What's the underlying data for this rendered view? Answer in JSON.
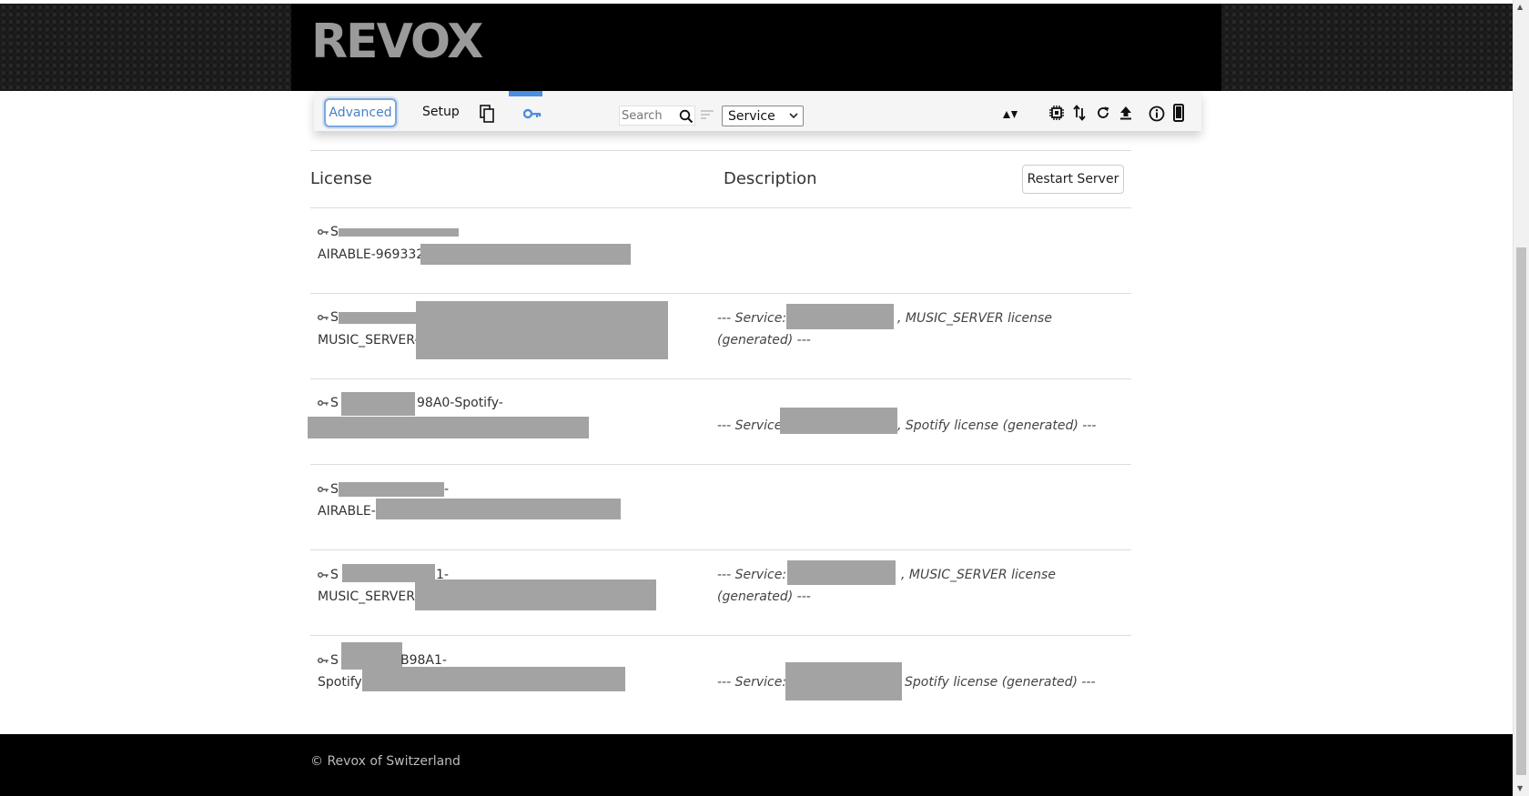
{
  "header": {
    "logo_text": "REVOX"
  },
  "toolbar": {
    "advanced_label": "Advanced",
    "setup_label": "Setup",
    "search_placeholder": "Search",
    "service_select_value": "Service",
    "icons": [
      "copy-icon",
      "key-icon",
      "search-icon",
      "sort-icon",
      "sort-updown-icon",
      "chip-icon",
      "transfer-icon",
      "refresh-icon",
      "upload-icon",
      "info-icon",
      "mobile-icon"
    ],
    "active_tab_color": "#4a8ee0"
  },
  "table": {
    "headers": {
      "license": "License",
      "description": "Description"
    },
    "restart_label": "Restart Server",
    "rows": [
      {
        "line1": "S",
        "line2": "AIRABLE-969332",
        "description": ""
      },
      {
        "line1": "S",
        "line2": "MUSIC_SERVER-",
        "description": "--- Service: , MUSIC_SERVER license (generated) ---",
        "description_line1": "--- Service:",
        "description_line1_suffix": ", MUSIC_SERVER license",
        "description_line2": "(generated) ---"
      },
      {
        "line1": "S",
        "line1_suffix": "98A0-Spotify-",
        "line2": "",
        "description_prefix": "--- Service:",
        "description_suffix": ", Spotify license (generated) ---"
      },
      {
        "line1": "S",
        "line1_suffix": "-",
        "line2": "AIRABLE-2",
        "description": ""
      },
      {
        "line1": "S",
        "line1_suffix": "1-",
        "line2": "MUSIC_SERVER-",
        "description_line1": "--- Service: :",
        "description_line1_suffix": ", MUSIC_SERVER license",
        "description_line2": "(generated) ---"
      },
      {
        "line1": "S",
        "line1_suffix": "B98A1-",
        "line2": "Spotify-",
        "description_prefix": "--- Service:",
        "description_suffix": "Spotify license (generated) ---"
      }
    ]
  },
  "footer": {
    "copyright": "© Revox of Switzerland"
  },
  "colors": {
    "header_bg": "#000000",
    "logo": "#9a9a9a",
    "accent": "#4a8ee0",
    "redaction": "#a3a3a3",
    "footer_bg": "#000000"
  }
}
